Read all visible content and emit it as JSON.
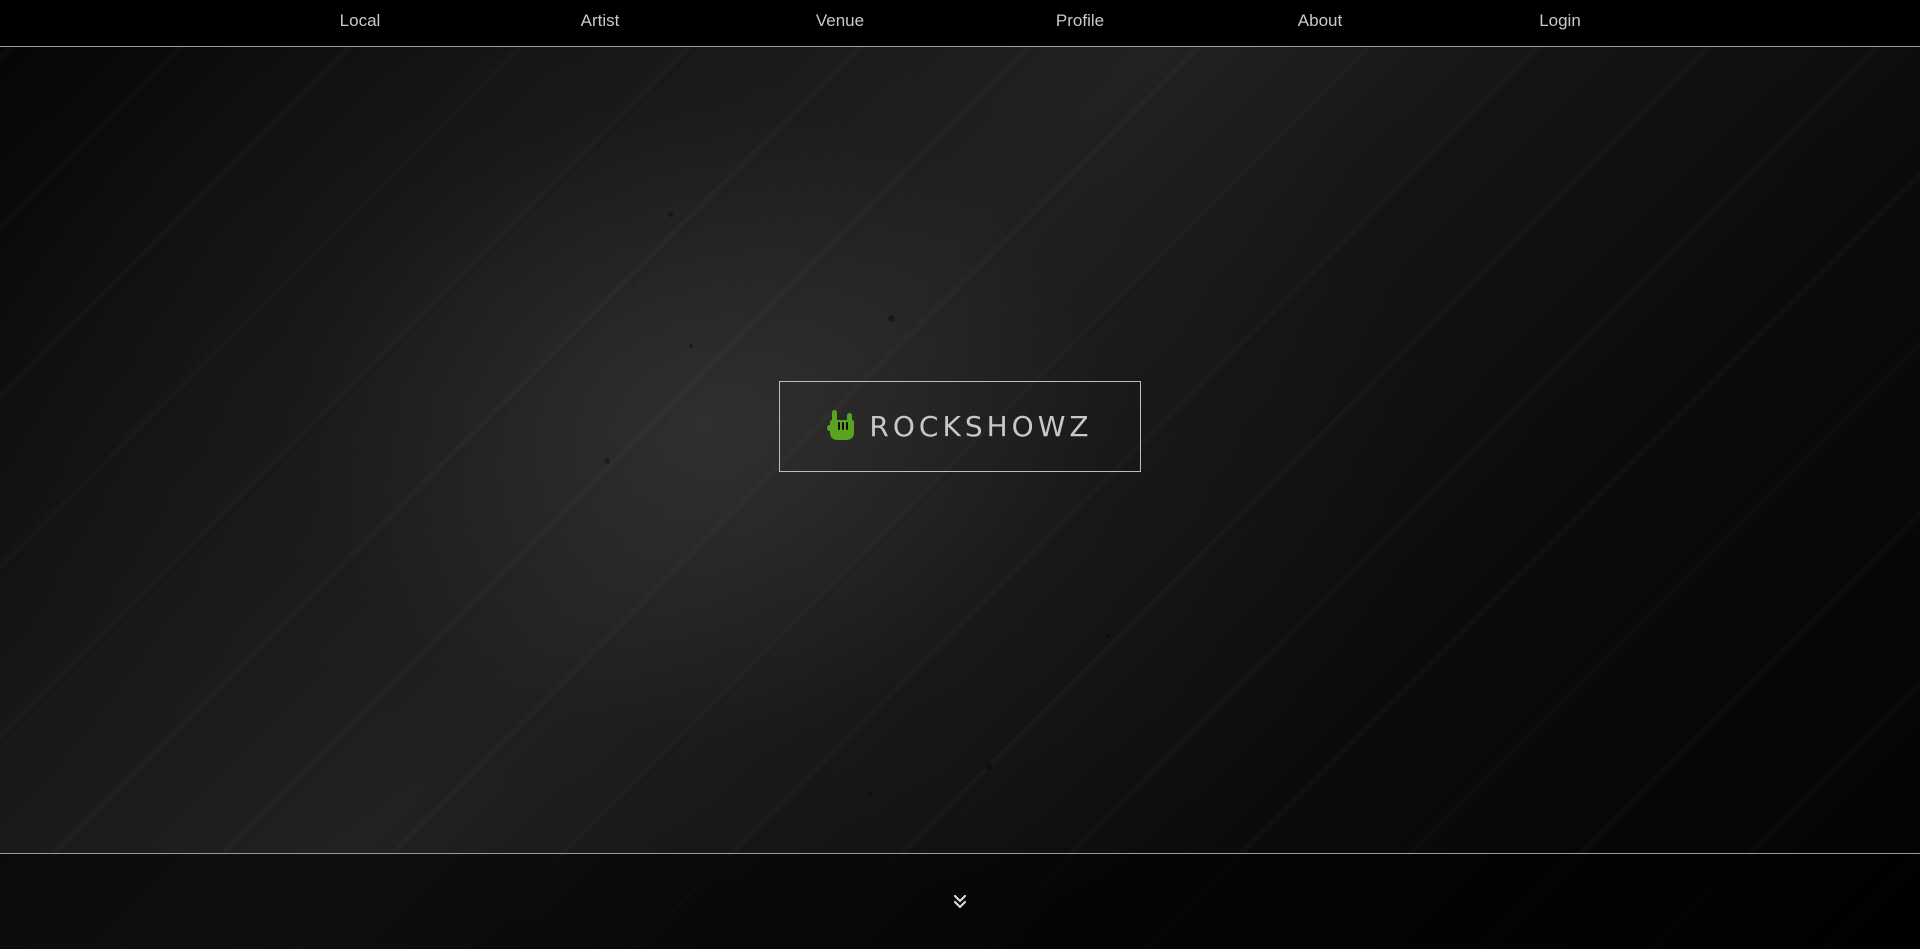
{
  "nav": {
    "items": [
      {
        "label": "Local"
      },
      {
        "label": "Artist"
      },
      {
        "label": "Venue"
      },
      {
        "label": "Profile"
      },
      {
        "label": "About"
      },
      {
        "label": "Login"
      }
    ]
  },
  "hero": {
    "brand": "ROCKSHOWZ",
    "icon": "rock-hand-icon"
  },
  "footer": {
    "scroll_icon": "double-chevron-down-icon"
  },
  "colors": {
    "accent": "#5aa321",
    "text": "#c8c8c8",
    "background": "#000000"
  }
}
